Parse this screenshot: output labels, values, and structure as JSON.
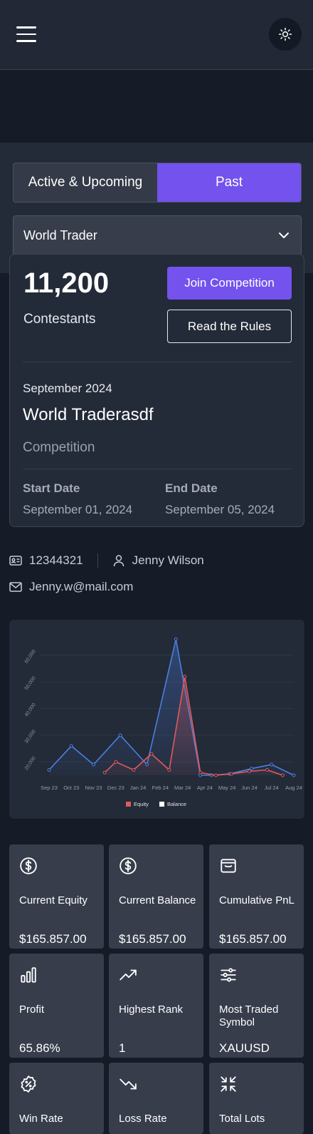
{
  "header": {
    "menu_icon": "hamburger-menu-icon",
    "theme_icon": "sun-icon"
  },
  "tabs": [
    {
      "label": "Active & Upcoming",
      "active": false
    },
    {
      "label": "Past",
      "active": true
    }
  ],
  "competition_select": {
    "value": "World Trader"
  },
  "competition": {
    "contestants_count": "11,200",
    "contestants_label": "Contestants",
    "join_label": "Join Competition",
    "rules_label": "Read the Rules",
    "period": "September 2024",
    "name": "World Traderasdf",
    "type": "Competition",
    "start_label": "Start Date",
    "start_value": "September 01, 2024",
    "end_label": "End Date",
    "end_value": "September 05, 2024"
  },
  "user": {
    "id": "12344321",
    "name": "Jenny Wilson",
    "email": "Jenny.w@mail.com"
  },
  "colors": {
    "accent": "#7352ee",
    "equity": "#e05a5a",
    "balance": "#4a7fe0"
  },
  "chart_data": {
    "type": "area",
    "categories": [
      "Sep 23",
      "Oct 23",
      "Nov 23",
      "Dec 23",
      "Jan 24",
      "Feb 24",
      "Mar 24",
      "Apr 24",
      "May 24",
      "Jun 24",
      "Jul 24",
      "Aug 24"
    ],
    "y_ticks": [
      "20,000",
      "30,000",
      "40,000",
      "50,000",
      "60,000"
    ],
    "ylim": [
      15000,
      65000
    ],
    "series": [
      {
        "name": "Equity",
        "color": "#e05a5a",
        "x": [
          2.5,
          3.0,
          3.8,
          4.6,
          5.4,
          6.1,
          6.8,
          7.5,
          8.2,
          9.0,
          9.8,
          10.5
        ],
        "y": [
          16000,
          20000,
          17000,
          23000,
          17000,
          52000,
          16000,
          15000,
          15500,
          16500,
          17000,
          15000
        ]
      },
      {
        "name": "Balance",
        "color": "#4a7fe0",
        "x": [
          0,
          1.0,
          2.0,
          3.2,
          4.4,
          5.7,
          6.8,
          7.3,
          8.1,
          9.1,
          10.0,
          11.0
        ],
        "y": [
          17000,
          26000,
          19000,
          30000,
          19000,
          66000,
          15000,
          15000,
          15500,
          17500,
          19000,
          15000
        ]
      }
    ],
    "legend": [
      "Equity",
      "Balance"
    ],
    "legend_position": "bottom",
    "grid": true
  },
  "stats": [
    {
      "label": "Current Equity",
      "value": "$165.857.00",
      "icon": "dollar-circle-icon"
    },
    {
      "label": "Current Balance",
      "value": "$165.857.00",
      "icon": "dollar-circle-icon"
    },
    {
      "label": "Cumulative PnL",
      "value": "$165.857.00",
      "icon": "wallet-icon"
    },
    {
      "label": "Profit",
      "value": "65.86%",
      "icon": "bar-chart-icon"
    },
    {
      "label": "Highest Rank",
      "value": "1",
      "icon": "trending-up-icon"
    },
    {
      "label": "Most Traded Symbol",
      "value": "XAUUSD",
      "icon": "sliders-icon"
    },
    {
      "label": "Win Rate",
      "value": "",
      "icon": "percent-badge-icon"
    },
    {
      "label": "Loss Rate",
      "value": "",
      "icon": "trending-down-icon"
    },
    {
      "label": "Total Lots",
      "value": "",
      "icon": "collapse-icon"
    }
  ]
}
